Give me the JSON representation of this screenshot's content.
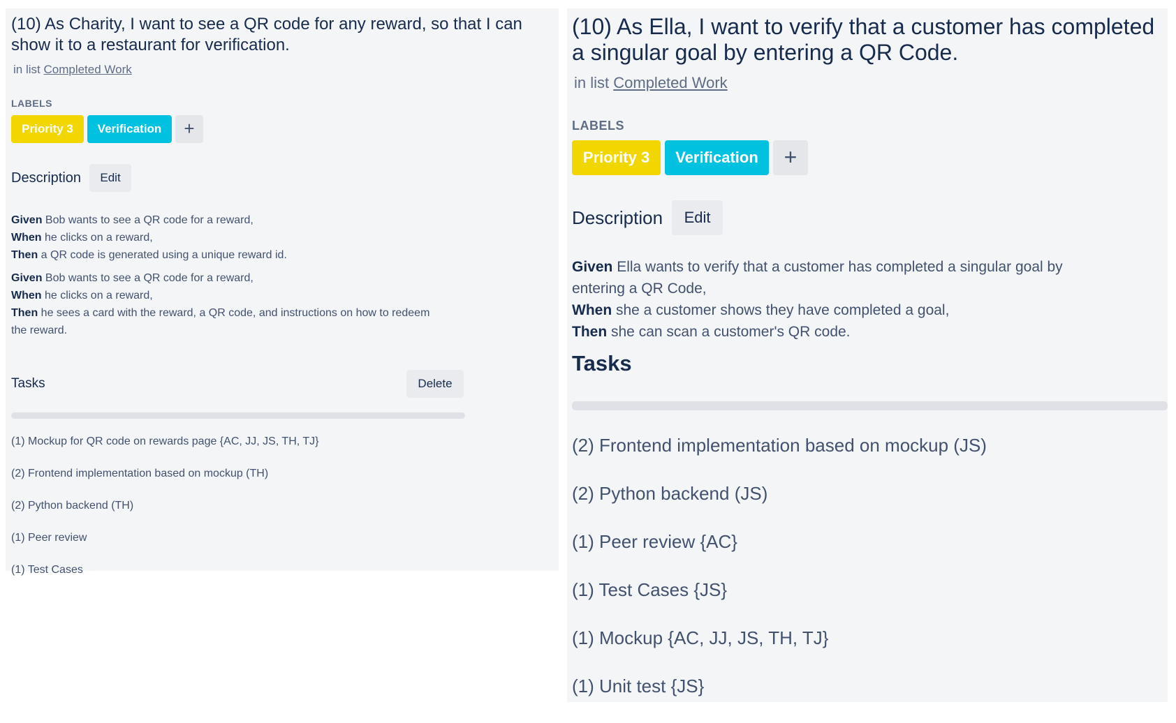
{
  "cards": [
    {
      "title": "(10) As Charity, I want to see a QR code for any reward, so that I can show it to a restaurant for verification.",
      "list_prefix": "in list",
      "list_name": "Completed Work",
      "labels_heading": "LABELS",
      "labels": [
        {
          "text": "Priority 3",
          "color": "#f2d600"
        },
        {
          "text": "Verification",
          "color": "#00c2e0"
        }
      ],
      "add_label_icon": "+",
      "description_heading": "Description",
      "edit_label": "Edit",
      "description": [
        [
          {
            "kw": "Given",
            "text": " Bob wants to see a QR code for a reward,"
          },
          {
            "kw": "When",
            "text": " he clicks on a reward,"
          },
          {
            "kw": "Then",
            "text": " a QR code is generated using a unique reward id."
          }
        ],
        [
          {
            "kw": "Given",
            "text": " Bob wants to see a QR code for a reward,"
          },
          {
            "kw": "When",
            "text": " he clicks on a reward,"
          },
          {
            "kw": "Then",
            "text": " he sees a card with the reward, a QR code, and instructions on how to redeem the reward."
          }
        ]
      ],
      "tasks_heading": "Tasks",
      "delete_label": "Delete",
      "tasks": [
        "(1) Mockup for QR code on rewards page {AC, JJ, JS, TH, TJ}",
        "(2) Frontend implementation based on mockup (TH)",
        "(2) Python backend (TH)",
        "(1) Peer review",
        "(1) Test Cases"
      ]
    },
    {
      "title": "(10) As Ella, I want to verify that a customer has completed a singular goal by entering a QR Code.",
      "list_prefix": "in list",
      "list_name": "Completed Work",
      "labels_heading": "LABELS",
      "labels": [
        {
          "text": "Priority 3",
          "color": "#f2d600"
        },
        {
          "text": "Verification",
          "color": "#00c2e0"
        }
      ],
      "add_label_icon": "+",
      "description_heading": "Description",
      "edit_label": "Edit",
      "description": [
        [
          {
            "kw": "Given",
            "text": " Ella wants to verify that a customer has completed a singular goal by entering a QR Code,"
          },
          {
            "kw": "When",
            "text": " she a customer shows they have completed a goal,"
          },
          {
            "kw": "Then",
            "text": " she can scan a customer's QR code."
          }
        ]
      ],
      "tasks_heading": "Tasks",
      "tasks": [
        "(2) Frontend implementation based on mockup (JS)",
        "(2) Python backend (JS)",
        "(1) Peer review {AC}",
        "(1) Test Cases {JS}",
        "(1) Mockup {AC, JJ, JS, TH, TJ}",
        "(1) Unit test {JS}"
      ]
    }
  ]
}
